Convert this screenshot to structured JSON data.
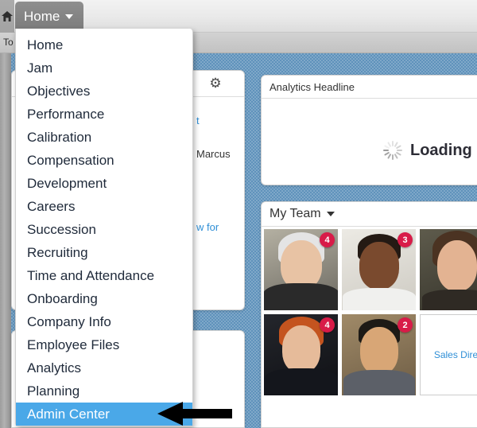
{
  "window": {
    "home_icon": "home-icon"
  },
  "top_tab": {
    "label": "Home",
    "caret": "chevron-down-icon"
  },
  "toolbar": {
    "todo_label": "To"
  },
  "dropdown": {
    "items": [
      {
        "label": "Home",
        "selected": false
      },
      {
        "label": "Jam",
        "selected": false
      },
      {
        "label": "Objectives",
        "selected": false
      },
      {
        "label": "Performance",
        "selected": false
      },
      {
        "label": "Calibration",
        "selected": false
      },
      {
        "label": "Compensation",
        "selected": false
      },
      {
        "label": "Development",
        "selected": false
      },
      {
        "label": "Careers",
        "selected": false
      },
      {
        "label": "Succession",
        "selected": false
      },
      {
        "label": "Recruiting",
        "selected": false
      },
      {
        "label": "Time and Attendance",
        "selected": false
      },
      {
        "label": "Onboarding",
        "selected": false
      },
      {
        "label": "Company Info",
        "selected": false
      },
      {
        "label": "Employee Files",
        "selected": false
      },
      {
        "label": "Analytics",
        "selected": false
      },
      {
        "label": "Planning",
        "selected": false
      },
      {
        "label": "Admin Center",
        "selected": true
      }
    ],
    "selected_label": "Admin Center",
    "highlight_color": "#4aa8e8"
  },
  "left_panel": {
    "gear_icon": "gear-icon",
    "lines": [
      {
        "text": "t",
        "kind": "link"
      },
      {
        "text": "Marcus",
        "kind": "body"
      },
      {
        "text": "w for",
        "kind": "link"
      }
    ]
  },
  "analytics_panel": {
    "title": "Analytics Headline",
    "loading_text": "Loading",
    "spinner_icon": "loading-spinner-icon"
  },
  "team_panel": {
    "title": "My Team",
    "caret": "chevron-down-icon",
    "rows": [
      [
        {
          "type": "photo",
          "badge": "4",
          "skin": "#e8c3a4",
          "hair": "#dcdcdc",
          "suit": "#2a2a2a",
          "bg": "#9c9a8f"
        },
        {
          "type": "photo",
          "badge": "3",
          "skin": "#7a4a2e",
          "hair": "#241a14",
          "suit": "#f0f0ee",
          "bg": "#dedcd6"
        },
        {
          "type": "photo",
          "badge": "",
          "skin": "#e3b392",
          "hair": "#4b3322",
          "suit": "#2f2a24",
          "bg": "#4c4a3e"
        }
      ],
      [
        {
          "type": "photo",
          "badge": "4",
          "skin": "#e6bb9a",
          "hair": "#c4541f",
          "suit": "#14161c",
          "bg": "#1b1d22"
        },
        {
          "type": "photo",
          "badge": "2",
          "skin": "#d8a676",
          "hair": "#1d1a16",
          "suit": "#5c6068",
          "bg": "#87765e"
        },
        {
          "type": "text",
          "badge": "",
          "label": "Sales Direc"
        }
      ]
    ]
  },
  "colors": {
    "page_background": "#5f92bb",
    "badge": "#d81b48",
    "link": "#2f8fd6",
    "tab": "#848484"
  }
}
